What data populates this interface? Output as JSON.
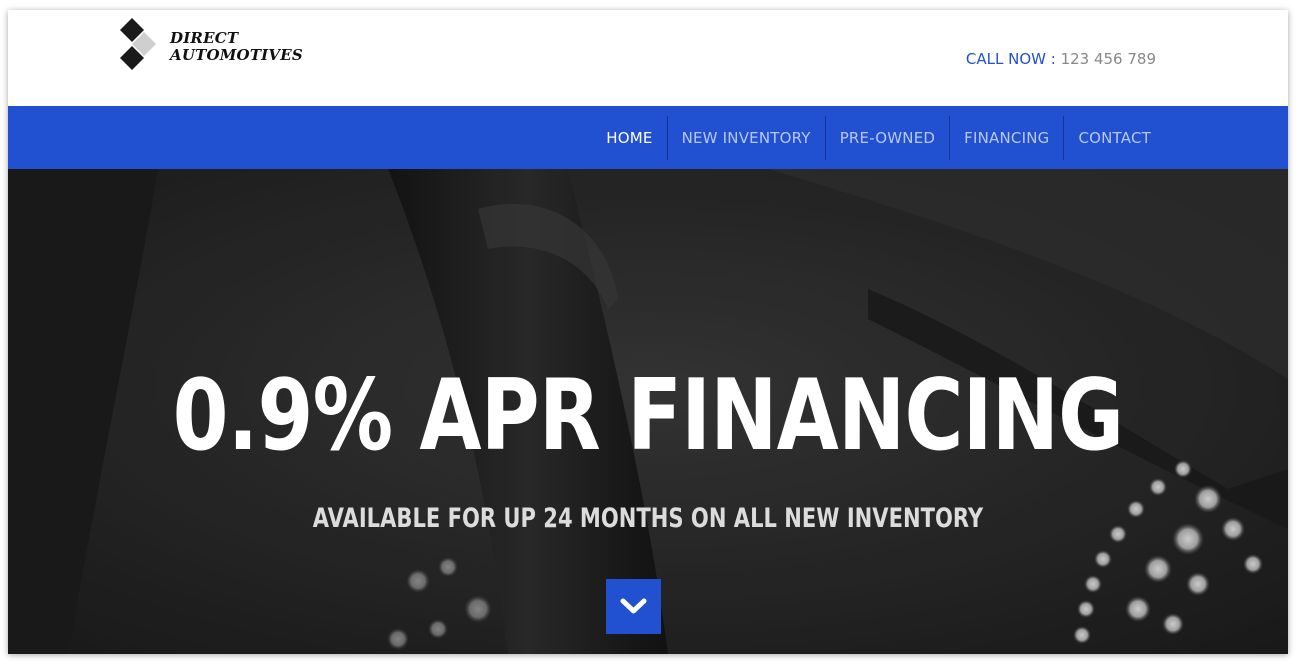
{
  "brand": {
    "line1": "DIRECT",
    "line2": "AUTOMOTIVES",
    "logo_icon": "diamond-stack-icon"
  },
  "contact": {
    "label": "CALL NOW",
    "colon": " : ",
    "phone": "123 456 789"
  },
  "nav": {
    "items": [
      {
        "label": "HOME",
        "active": true
      },
      {
        "label": "NEW INVENTORY",
        "active": false
      },
      {
        "label": "PRE-OWNED",
        "active": false
      },
      {
        "label": "FINANCING",
        "active": false
      },
      {
        "label": "CONTACT",
        "active": false
      }
    ]
  },
  "hero": {
    "headline": "0.9% APR FINANCING",
    "subline": "AVAILABLE FOR UP 24 MONTHS ON ALL NEW INVENTORY",
    "scroll_icon": "chevron-down-icon"
  },
  "colors": {
    "accent": "#2150d0",
    "nav_text": "#b9c8f3",
    "hero_bg": "#2a2a2a"
  }
}
